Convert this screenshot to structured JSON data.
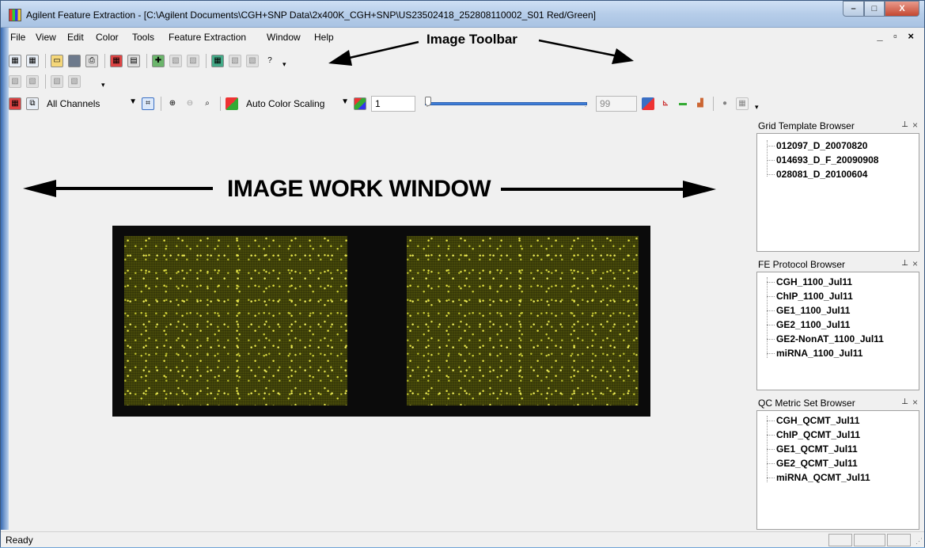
{
  "window": {
    "title": "Agilent Feature Extraction - [C:\\Agilent Documents\\CGH+SNP Data\\2x400K_CGH+SNP\\US23502418_252808110002_S01 Red/Green]",
    "controls": {
      "minimize": "–",
      "maximize": "□",
      "close": "X"
    },
    "mdi_controls": "_ ▫ ×"
  },
  "menu": [
    "File",
    "View",
    "Edit",
    "Color",
    "Tools",
    "Feature Extraction",
    "Window",
    "Help"
  ],
  "annotations": {
    "toolbar_label": "Image Toolbar",
    "work_window_label": "IMAGE WORK WINDOW"
  },
  "image_toolbar": {
    "channels_select": "All Channels",
    "color_scaling_select": "Auto Color Scaling",
    "scale_value": "1",
    "slider_max_value": "99",
    "slider_level": 0.0
  },
  "browsers": {
    "grid_template": {
      "title": "Grid Template Browser",
      "items": [
        "012097_D_20070820",
        "014693_D_F_20090908",
        "028081_D_20100604"
      ]
    },
    "fe_protocol": {
      "title": "FE Protocol Browser",
      "items": [
        "CGH_1100_Jul11",
        "ChIP_1100_Jul11",
        "GE1_1100_Jul11",
        "GE2_1100_Jul11",
        "GE2-NonAT_1100_Jul11",
        "miRNA_1100_Jul11"
      ]
    },
    "qc_metric": {
      "title": "QC Metric Set Browser",
      "items": [
        "CGH_QCMT_Jul11",
        "ChIP_QCMT_Jul11",
        "GE1_QCMT_Jul11",
        "GE2_QCMT_Jul11",
        "miRNA_QCMT_Jul11"
      ]
    },
    "pin_glyph": "ᵾ",
    "close_glyph": "×"
  },
  "status": {
    "text": "Ready"
  },
  "icons": {
    "toolbar1": [
      "open-image-icon",
      "open-multiple-icon",
      "open-folder-icon",
      "save-icon",
      "print-icon",
      "grid-icon",
      "layout-icon",
      "extract-icon",
      "project-icon",
      "report-icon",
      "batch-icon",
      "qc-icon",
      "export-icon",
      "help-icon"
    ],
    "toolbar2": [
      "run-icon",
      "run-all-icon",
      "copy-icon",
      "paste-icon"
    ]
  }
}
